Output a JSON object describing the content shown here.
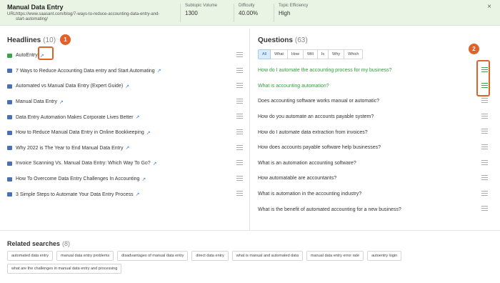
{
  "header": {
    "title": "Manual Data Entry",
    "url_label": "URL:",
    "url": "https://www.saasant.com/blog/7-ways-to-reduce-accounting-data-entry-and-start-automating/",
    "metrics": [
      {
        "label": "Subtopic Volume",
        "value": "1300"
      },
      {
        "label": "Difficulty",
        "value": "40.00%"
      },
      {
        "label": "Topic Efficiency",
        "value": "High"
      }
    ],
    "close_glyph": "×"
  },
  "headlines": {
    "title": "Headlines",
    "count": "(10)",
    "items": [
      {
        "text": "AutoEntry"
      },
      {
        "text": "7 Ways to Reduce Accounting Data entry and Start Automating"
      },
      {
        "text": "Automated vs Manual Data Entry (Expert Guide)"
      },
      {
        "text": "Manual Data Entry"
      },
      {
        "text": "Data Entry Automation Makes Corporate Lives Better"
      },
      {
        "text": "How to Reduce Manual Data Entry in Online Bookkeeping"
      },
      {
        "text": "Why 2022 is The Year to End Manual Data Entry"
      },
      {
        "text": "Invoice Scanning Vs. Manual Data Entry: Which Way To Go?"
      },
      {
        "text": "How To Overcome Data Entry Challenges In Accounting"
      },
      {
        "text": "3 Simple Steps to Automate Your Data Entry Process"
      }
    ]
  },
  "questions": {
    "title": "Questions",
    "count": "(63)",
    "filters": [
      "All",
      "What",
      "How",
      "Will",
      "Is",
      "Why",
      "Which"
    ],
    "active_filter": "All",
    "items": [
      {
        "text": "How do I automate the accounting process for my business?",
        "selected": true
      },
      {
        "text": "What is accounting automation?",
        "selected": true
      },
      {
        "text": "Does accounting software works manual or automatic?",
        "selected": false
      },
      {
        "text": "How do you automate an accounts payable system?",
        "selected": false
      },
      {
        "text": "How do I automate data extraction from invoices?",
        "selected": false
      },
      {
        "text": "How does accounts payable software help businesses?",
        "selected": false
      },
      {
        "text": "What is an automation accounting software?",
        "selected": false
      },
      {
        "text": "How automatable are accountants?",
        "selected": false
      },
      {
        "text": "What is automation in the accounting industry?",
        "selected": false
      },
      {
        "text": "What is the benefit of automated accounting for a new business?",
        "selected": false
      }
    ]
  },
  "callouts": [
    "1",
    "2"
  ],
  "related": {
    "title": "Related searches",
    "count": "(8)",
    "tags": [
      "automated data entry",
      "manual data entry problems",
      "disadvantages of manual data entry",
      "direct data entry",
      "what is manual and automated data",
      "manual data entry error rate",
      "autoentry login",
      "what are the challenges in manual data entry and processing"
    ]
  },
  "colors": {
    "accent_green": "#3aa34a",
    "callout_orange": "#e0622b",
    "header_bg": "#e9f4e4",
    "link_blue": "#3a7bd5"
  },
  "icons": {
    "external_link": "external-link-icon",
    "headline": "headline-icon",
    "add_to_list": "add-to-list-icon",
    "close": "close-icon"
  }
}
